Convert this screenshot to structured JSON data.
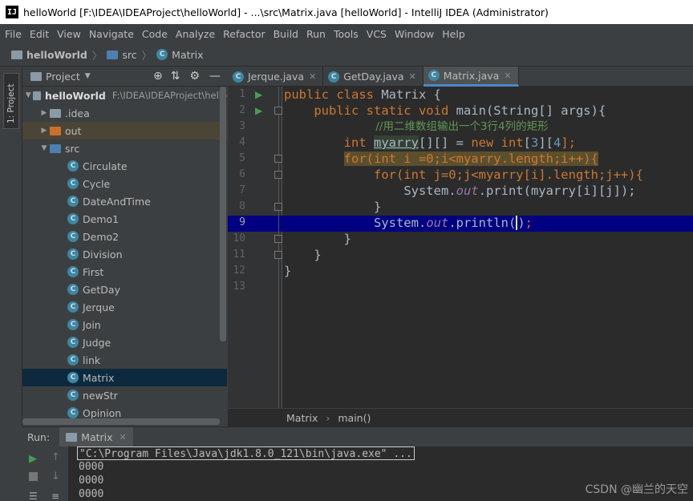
{
  "window": {
    "title": "helloWorld [F:\\IDEA\\IDEAProject\\helloWorld] - ...\\src\\Matrix.java [helloWorld] - IntelliJ IDEA (Administrator)",
    "icon": "IJ"
  },
  "menu": [
    "File",
    "Edit",
    "View",
    "Navigate",
    "Code",
    "Analyze",
    "Refactor",
    "Build",
    "Run",
    "Tools",
    "VCS",
    "Window",
    "Help"
  ],
  "breadcrumb": {
    "project": "helloWorld",
    "folder": "src",
    "file": "Matrix"
  },
  "sidebar_strip": {
    "label": "1: Project"
  },
  "project_panel": {
    "title": "Project",
    "root": {
      "name": "helloWorld",
      "path": "F:\\IDEA\\IDEAProject\\hello"
    },
    "folders": [
      ".idea",
      "out",
      "src"
    ],
    "classes": [
      "Circulate",
      "Cycle",
      "DateAndTime",
      "Demo1",
      "Demo2",
      "Division",
      "First",
      "GetDay",
      "Jerque",
      "Join",
      "Judge",
      "link",
      "Matrix",
      "newStr",
      "Opinion"
    ],
    "selected": "Matrix"
  },
  "tabs": [
    {
      "label": "Jerque.java"
    },
    {
      "label": "GetDay.java"
    },
    {
      "label": "Matrix.java"
    }
  ],
  "active_tab": "Matrix.java",
  "code": {
    "line_numbers": [
      "1",
      "2",
      "3",
      "4",
      "5",
      "6",
      "7",
      "8",
      "9",
      "10",
      "11",
      "12",
      "13"
    ],
    "current_line": "9",
    "l1_kw": "public class ",
    "l1_rest": "Matrix {",
    "l2_kw": "public static void ",
    "l2_rest": "main(String[] args){",
    "l3_comment": "//用二维数组输出一个3行4列的矩形",
    "l4_kw": "int ",
    "l4_var": "myarry",
    "l4_a": "[][] = ",
    "l4_new": "new int",
    "l4_b": "[",
    "l4_n3": "3",
    "l4_c": "][",
    "l4_n4": "4",
    "l4_d": "];",
    "l5": "for(int i =0;i<myarry.length;i++){",
    "l6": "for(int j=0;j<myarry[i].length;j++){",
    "l7_a": "System.",
    "l7_out": "out",
    "l7_b": ".print(myarry[i][j]);",
    "l8": "}",
    "l9_a": "System.",
    "l9_out": "out",
    "l9_b": ".println(",
    "l9_c": ")",
    "l9_semi": ";",
    "l10": "}",
    "l11": "}",
    "l12": "}"
  },
  "editor_breadcrumb": {
    "class": "Matrix",
    "method": "main()"
  },
  "run_panel": {
    "label": "Run:",
    "config": "Matrix"
  },
  "console": {
    "lines": [
      "\"C:\\Program Files\\Java\\jdk1.8.0_121\\bin\\java.exe\" ...",
      "0000",
      "0000",
      "0000"
    ]
  },
  "watermark": "CSDN @幽兰的天空",
  "colors": {
    "accent": "#4a88c7",
    "selection": "#0d3a72",
    "current_line_hl": "#000080"
  }
}
